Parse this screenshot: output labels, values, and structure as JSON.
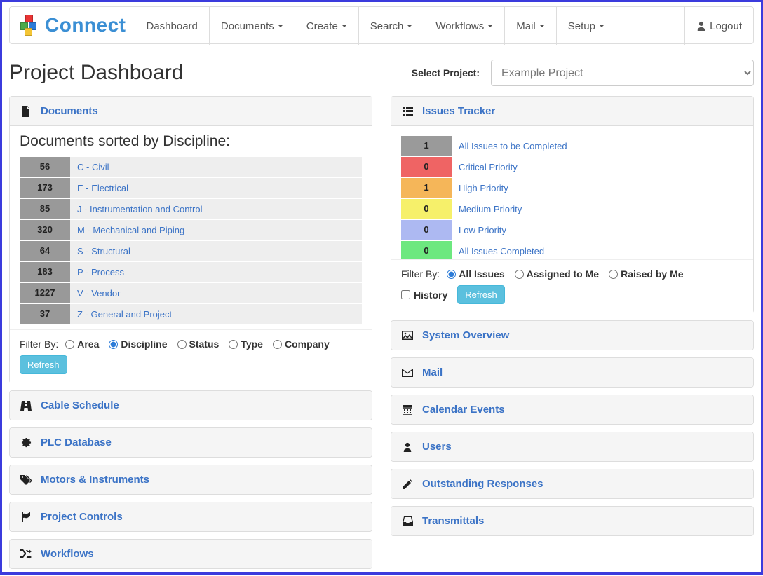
{
  "brand": {
    "text": "Connect"
  },
  "nav": {
    "dashboard": "Dashboard",
    "documents": "Documents",
    "create": "Create",
    "search": "Search",
    "workflows": "Workflows",
    "mail": "Mail",
    "setup": "Setup",
    "logout": "Logout"
  },
  "header": {
    "title": "Project Dashboard",
    "select_label": "Select Project:",
    "project_options": [
      "Example Project"
    ]
  },
  "documents_panel": {
    "title": "Documents",
    "subtitle": "Documents sorted by Discipline:",
    "rows": [
      {
        "count": "56",
        "label": "C - Civil"
      },
      {
        "count": "173",
        "label": "E - Electrical"
      },
      {
        "count": "85",
        "label": "J - Instrumentation and Control"
      },
      {
        "count": "320",
        "label": "M - Mechanical and Piping"
      },
      {
        "count": "64",
        "label": "S - Structural"
      },
      {
        "count": "183",
        "label": "P - Process"
      },
      {
        "count": "1227",
        "label": "V - Vendor"
      },
      {
        "count": "37",
        "label": "Z - General and Project"
      }
    ],
    "filter_label": "Filter By:",
    "filters": {
      "area": "Area",
      "discipline": "Discipline",
      "status": "Status",
      "type": "Type",
      "company": "Company"
    },
    "refresh": "Refresh"
  },
  "left_panels": {
    "cable": "Cable Schedule",
    "plc": "PLC Database",
    "motors": "Motors & Instruments",
    "controls": "Project Controls",
    "workflows": "Workflows"
  },
  "issues_panel": {
    "title": "Issues Tracker",
    "rows": [
      {
        "count": "1",
        "label": "All Issues to be Completed",
        "color": "#9a9a9a"
      },
      {
        "count": "0",
        "label": "Critical Priority",
        "color": "#ef6464"
      },
      {
        "count": "1",
        "label": "High Priority",
        "color": "#f5b659"
      },
      {
        "count": "0",
        "label": "Medium Priority",
        "color": "#f6f06a"
      },
      {
        "count": "0",
        "label": "Low Priority",
        "color": "#adb9f2"
      },
      {
        "count": "0",
        "label": "All Issues Completed",
        "color": "#6de87f"
      }
    ],
    "filter_label": "Filter By:",
    "filters": {
      "all": "All Issues",
      "assigned": "Assigned to Me",
      "raised": "Raised by Me"
    },
    "history": "History",
    "refresh": "Refresh"
  },
  "right_panels": {
    "overview": "System Overview",
    "mail": "Mail",
    "calendar": "Calendar Events",
    "users": "Users",
    "responses": "Outstanding Responses",
    "transmittals": "Transmittals"
  }
}
